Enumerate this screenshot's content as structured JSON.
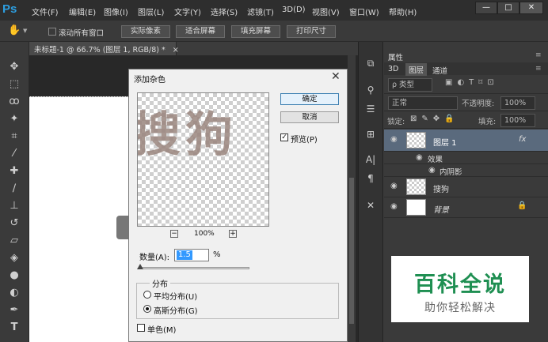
{
  "app": {
    "logo": "Ps"
  },
  "menu": [
    "文件(F)",
    "编辑(E)",
    "图像(I)",
    "图层(L)",
    "文字(Y)",
    "选择(S)",
    "滤镜(T)",
    "3D(D)",
    "视图(V)",
    "窗口(W)",
    "帮助(H)"
  ],
  "window_buttons": {
    "minimize": "—",
    "maximize": "□",
    "close": "✕"
  },
  "options": {
    "scroll_all": "滚动所有窗口",
    "actual_pixels": "实际像素",
    "fit_screen": "适合屏幕",
    "fill_screen": "填充屏幕",
    "print_size": "打印尺寸"
  },
  "document": {
    "tab_title": "未标题-1 @ 66.7% (图层 1, RGB/8) *",
    "tab_close": "×"
  },
  "tools": [
    "move-tool-icon",
    "marquee-tool-icon",
    "lasso-tool-icon",
    "magic-wand-icon",
    "crop-tool-icon",
    "eyedropper-icon",
    "healing-brush-icon",
    "brush-tool-icon",
    "stamp-tool-icon",
    "history-brush-icon",
    "eraser-icon",
    "paint-bucket-icon",
    "blur-tool-icon",
    "dodge-tool-icon",
    "pen-tool-icon",
    "type-tool-icon"
  ],
  "panel": {
    "title": "属性",
    "tabs": [
      "3D",
      "图层",
      "通道"
    ],
    "kind_filter": "ρ 类型",
    "blend_mode": "正常",
    "opacity_label": "不透明度:",
    "opacity_value": "100%",
    "lock_label": "锁定:",
    "fill_label": "填充:",
    "fill_value": "100%",
    "layers": [
      {
        "name": "图层 1",
        "fx": "fx"
      },
      {
        "name": "效果"
      },
      {
        "name": "内阴影"
      },
      {
        "name": "搜狗"
      },
      {
        "name": "背景"
      }
    ]
  },
  "dialog": {
    "title": "添加杂色",
    "close": "✕",
    "preview_text": "搜狗",
    "ok": "确定",
    "cancel": "取消",
    "preview_checkbox": "预览(P)",
    "zoom_out": "−",
    "zoom": "100%",
    "zoom_in": "+",
    "amount_label": "数量(A):",
    "amount_value": "1.5",
    "amount_unit": "%",
    "distribution_label": "分布",
    "uniform": "平均分布(U)",
    "gaussian": "高斯分布(G)",
    "monochromatic": "单色(M)"
  },
  "watermark": {
    "line1": "百科全说",
    "line2": "助你轻松解决"
  }
}
